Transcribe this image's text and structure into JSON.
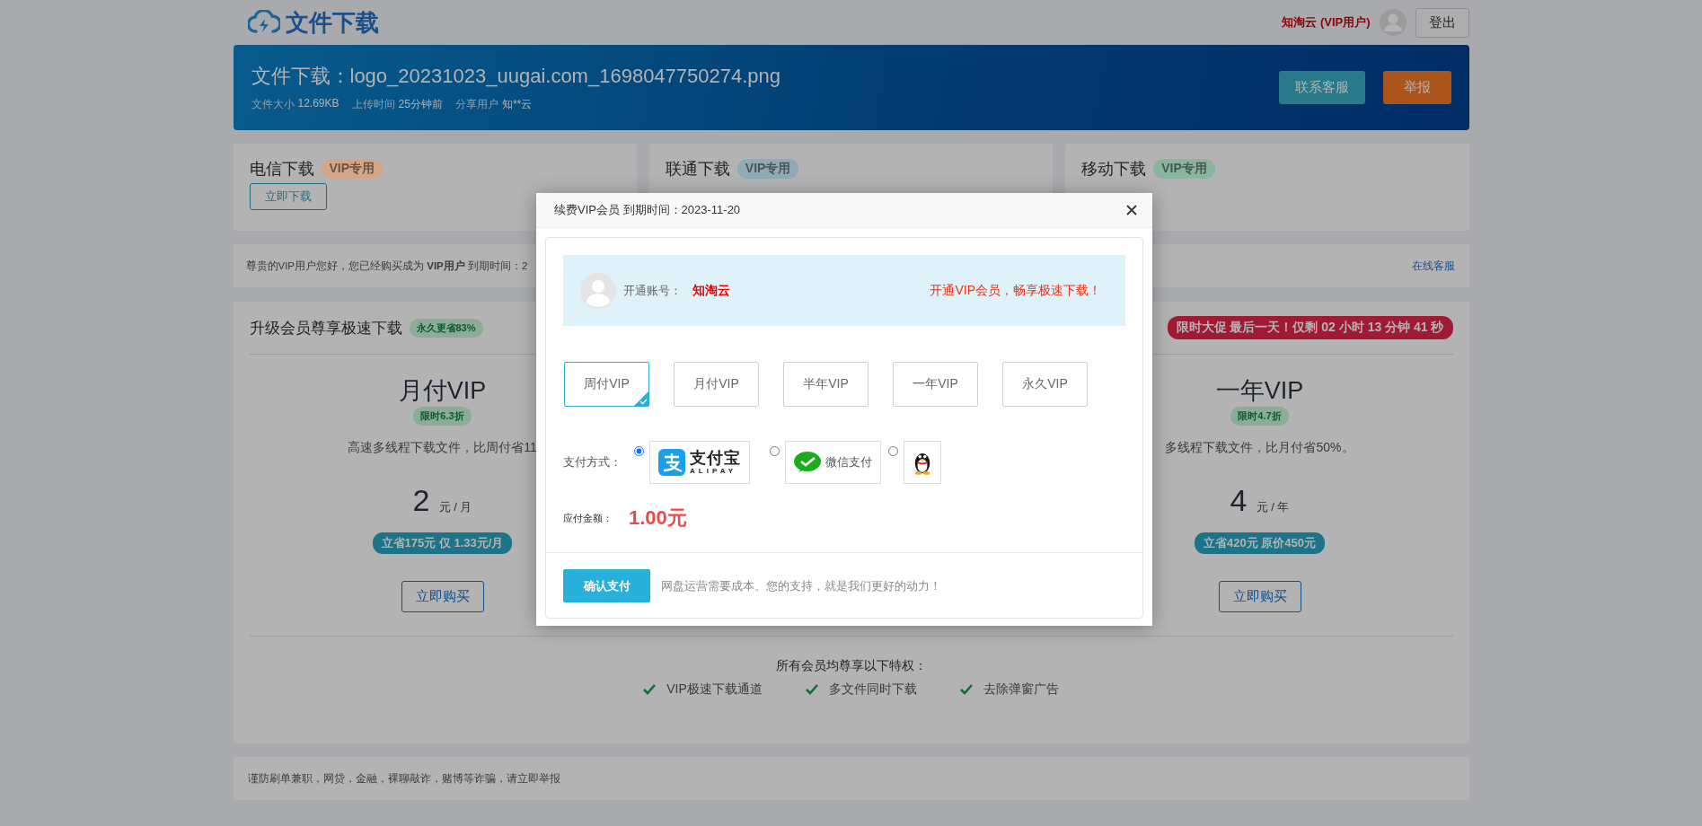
{
  "header": {
    "logo_text": "文件下载",
    "user": "知淘云 (VIP用户)",
    "logout": "登出"
  },
  "file_banner": {
    "title": "文件下载：logo_20231023_uugai.com_1698047750274.png",
    "meta": [
      {
        "label": "文件大小",
        "value": "12.69KB"
      },
      {
        "label": "上传时间",
        "value": "25分钟前"
      },
      {
        "label": "分享用户",
        "value": "知**云"
      }
    ],
    "buttons": [
      {
        "label": "联系客服",
        "kind": "contact"
      },
      {
        "label": "举报",
        "kind": "report"
      }
    ]
  },
  "download_cards": [
    {
      "title": "电信下载",
      "badge": "VIP专用",
      "color": "#d4a58a",
      "button": "立即下载"
    },
    {
      "title": "联通下载",
      "badge": "VIP专用",
      "color": "#8fabb6"
    },
    {
      "title": "移动下载",
      "badge": "VIP专用",
      "color": "#8cb39d"
    }
  ],
  "info_bar": {
    "text": "尊贵的VIP用户您好，您已经购买成为 **VIP用户** 到期时间：2",
    "link": "在线客服"
  },
  "plans": {
    "title": "升级会员尊享极速下载",
    "title_badge": "永久更省83%",
    "countdown": "限时大促 最后一天！仅剩 02 小时 13 分钟 41 秒",
    "items": [
      {
        "name": "月付VIP",
        "discount": "限时6.3折",
        "desc": "高速多线程下载文件，比周付省11",
        "price": "2",
        "unit": "元 / 月",
        "save": "立省175元 仅 1.33元/月",
        "button": "立即购买"
      },
      {
        "name": "一年VIP",
        "discount": "限时4.7折",
        "desc": "多线程下载文件，比月付省50%。",
        "price": "4",
        "unit": "元 / 年",
        "save": "立省420元 原价450元",
        "button": "立即购买"
      }
    ],
    "perks_title": "所有会员均尊享以下特权：",
    "perks": [
      "VIP极速下载通道",
      "多文件同时下载",
      "去除弹窗广告"
    ]
  },
  "footer_notice": "谨防刷单兼职，网贷，金融，裸聊敲诈，赌博等诈骗，请立即举报",
  "modal": {
    "title": "续费VIP会员 到期时间：2023-11-20",
    "account_label": "开通账号：",
    "account_name": "知淘云",
    "promo": "开通VIP会员，畅享极速下载！",
    "plans": [
      {
        "label": "周付VIP",
        "selected": true
      },
      {
        "label": "月付VIP",
        "selected": false
      },
      {
        "label": "半年VIP",
        "selected": false
      },
      {
        "label": "一年VIP",
        "selected": false
      },
      {
        "label": "永久VIP",
        "selected": false
      }
    ],
    "payment_label": "支付方式：",
    "payment_methods": [
      {
        "kind": "alipay",
        "selected": true,
        "name": "支付宝",
        "caption": "ALIPAY"
      },
      {
        "kind": "wechat",
        "selected": false,
        "name": "微信支付"
      },
      {
        "kind": "qq",
        "selected": false
      }
    ],
    "amount_label": "应付金额：",
    "amount": "1.00元",
    "confirm": "确认支付",
    "note": "网盘运营需要成本。您的支持，就是我们更好的动力！"
  }
}
